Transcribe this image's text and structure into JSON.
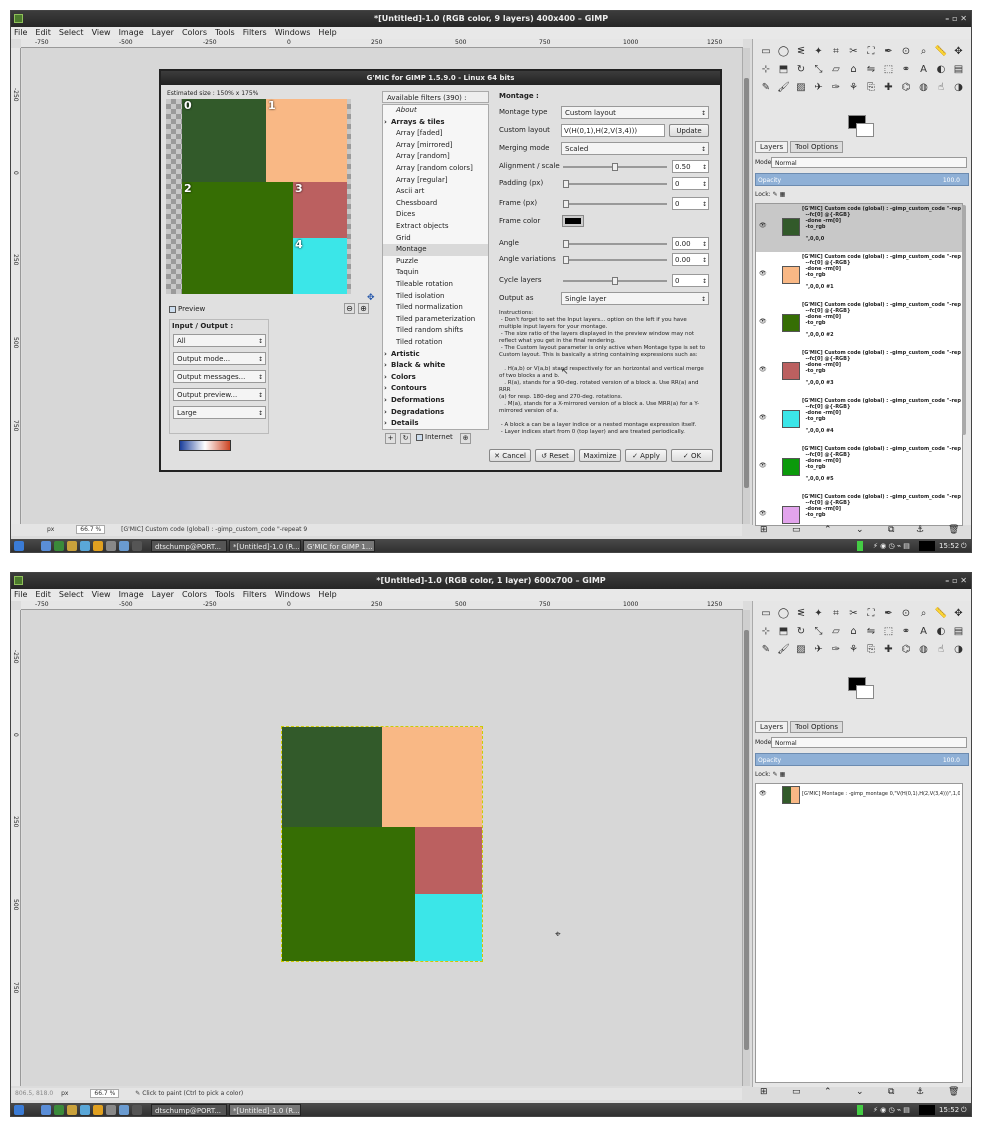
{
  "screen1": {
    "title": "*[Untitled]-1.0 (RGB color, 9 layers) 400x400 – GIMP",
    "menus": [
      "File",
      "Edit",
      "Select",
      "View",
      "Image",
      "Layer",
      "Colors",
      "Tools",
      "Filters",
      "Windows",
      "Help"
    ],
    "ruler_h": [
      "-750",
      "-500",
      "-250",
      "0",
      "250",
      "500",
      "750",
      "1000",
      "1250"
    ],
    "ruler_v": [
      "-250",
      "0",
      "250",
      "500",
      "750"
    ],
    "status": {
      "unit": "px",
      "zoom": "66.7 %",
      "message": "[G'MIC] Custom code (global) : -gimp_custom_code \"-repeat 9"
    },
    "gmic": {
      "title": "G'MIC for GIMP 1.5.9.0 - Linux 64 bits",
      "estimated": "Estimated size : 150% x 175%",
      "preview_blocks": [
        {
          "n": "0",
          "color": "#325a2a"
        },
        {
          "n": "1",
          "color": "#f9b885"
        },
        {
          "n": "2",
          "color": "#366e04"
        },
        {
          "n": "3",
          "color": "#bb6060"
        },
        {
          "n": "4",
          "color": "#3be6e8"
        }
      ],
      "preview_label": "Preview",
      "io_title": "Input / Output :",
      "io": [
        "All",
        "Output mode...",
        "Output messages...",
        "Output preview...",
        "Large"
      ],
      "filters_header": "Available filters (390) :",
      "filters": [
        {
          "t": "About",
          "k": "sub-it"
        },
        {
          "t": "Arrays & tiles",
          "k": "cat"
        },
        {
          "t": "Array [faded]",
          "k": "sub"
        },
        {
          "t": "Array [mirrored]",
          "k": "sub"
        },
        {
          "t": "Array [random]",
          "k": "sub"
        },
        {
          "t": "Array [random colors]",
          "k": "sub"
        },
        {
          "t": "Array [regular]",
          "k": "sub"
        },
        {
          "t": "Ascii art",
          "k": "sub"
        },
        {
          "t": "Chessboard",
          "k": "sub"
        },
        {
          "t": "Dices",
          "k": "sub"
        },
        {
          "t": "Extract objects",
          "k": "sub"
        },
        {
          "t": "Grid",
          "k": "sub"
        },
        {
          "t": "Montage",
          "k": "on"
        },
        {
          "t": "Puzzle",
          "k": "sub"
        },
        {
          "t": "Taquin",
          "k": "sub"
        },
        {
          "t": "Tileable rotation",
          "k": "sub"
        },
        {
          "t": "Tiled isolation",
          "k": "sub"
        },
        {
          "t": "Tiled normalization",
          "k": "sub"
        },
        {
          "t": "Tiled parameterization",
          "k": "sub"
        },
        {
          "t": "Tiled random shifts",
          "k": "sub"
        },
        {
          "t": "Tiled rotation",
          "k": "sub"
        },
        {
          "t": "Artistic",
          "k": "cat"
        },
        {
          "t": "Black & white",
          "k": "cat"
        },
        {
          "t": "Colors",
          "k": "cat"
        },
        {
          "t": "Contours",
          "k": "cat"
        },
        {
          "t": "Deformations",
          "k": "cat"
        },
        {
          "t": "Degradations",
          "k": "cat"
        },
        {
          "t": "Details",
          "k": "cat"
        }
      ],
      "internet": "Internet",
      "params_title": "Montage :",
      "montage_type_label": "Montage type",
      "montage_type": "Custom layout",
      "custom_layout_label": "Custom layout",
      "custom_layout": "V(H(0,1),H(2,V(3,4)))",
      "update": "Update",
      "merging_label": "Merging mode",
      "merging": "Scaled",
      "align_label": "Alignment / scale",
      "align": "0.50",
      "align_pos": 0.5,
      "padding_label": "Padding (px)",
      "padding": "0",
      "frame_label": "Frame (px)",
      "frame": "0",
      "frame_color_label": "Frame color",
      "frame_color": "#000000",
      "angle_label": "Angle",
      "angle": "0.00",
      "anglevar_label": "Angle variations",
      "anglevar": "0.00",
      "cycle_label": "Cycle layers",
      "cycle": "0",
      "cycle_pos": 0.5,
      "output_label": "Output as",
      "output": "Single layer",
      "instructions": "Instructions:\n - Don't forget to set the Input layers... option on the left if you have\nmultiple input layers for your montage.\n - The size ratio of the layers displayed in the preview window may not\nreflect what you get in the final rendering.\n - The Custom layout parameter is only active when Montage type is set to\nCustom layout. This is basically a string containing expressions such as:\n\n   . H(a,b) or V(a,b) stand respectively for an horizontal and vertical merge\nof two blocks a and b.\n   . R(a), stands for a 90-deg. rotated version of a block a. Use RR(a) and RRR\n(a) for resp. 180-deg and 270-deg. rotations.\n   . M(a), stands for a X-mirrored version of a block a. Use MRR(a) for a Y-\nmirrored version of a.\n\n - A block a can be a layer indice or a nested montage expression itself.\n - Layer indices start from 0 (top layer) and are treated periodically.",
      "buttons": [
        "Cancel",
        "Reset",
        "Maximize",
        "Apply",
        "OK"
      ]
    },
    "dock": {
      "tab_layers": "Layers",
      "tab_tool": "Tool Options",
      "mode_label": "Mode:",
      "mode": "Normal",
      "opacity_label": "Opacity",
      "opacity": "100.0",
      "lock_label": "Lock:",
      "layers": [
        {
          "text": "[G'MIC] Custom code (global) : -gimp_custom_code \"-rep\n  --fc[0] @{-RGB}\n  -done -rm[0]\n  -to_rgb\n\n  \",0,0,0",
          "color": "#325a2a",
          "sel": true
        },
        {
          "text": "[G'MIC] Custom code (global) : -gimp_custom_code \"-rep\n  --fc[0] @{-RGB}\n  -done -rm[0]\n  -to_rgb\n\n  \",0,0,0 #1",
          "color": "#f9b885",
          "sel": false
        },
        {
          "text": "[G'MIC] Custom code (global) : -gimp_custom_code \"-rep\n  --fc[0] @{-RGB}\n  -done -rm[0]\n  -to_rgb\n\n  \",0,0,0 #2",
          "color": "#366e04",
          "sel": false
        },
        {
          "text": "[G'MIC] Custom code (global) : -gimp_custom_code \"-rep\n  --fc[0] @{-RGB}\n  -done -rm[0]\n  -to_rgb\n\n  \",0,0,0 #3",
          "color": "#bb6060",
          "sel": false
        },
        {
          "text": "[G'MIC] Custom code (global) : -gimp_custom_code \"-rep\n  --fc[0] @{-RGB}\n  -done -rm[0]\n  -to_rgb\n\n  \",0,0,0 #4",
          "color": "#3be6e8",
          "sel": false
        },
        {
          "text": "[G'MIC] Custom code (global) : -gimp_custom_code \"-rep\n  --fc[0] @{-RGB}\n  -done -rm[0]\n  -to_rgb\n\n  \",0,0,0 #5",
          "color": "#0b9a0b",
          "sel": false
        },
        {
          "text": "[G'MIC] Custom code (global) : -gimp_custom_code \"-rep\n  --fc[0] @{-RGB}\n  -done -rm[0]\n  -to_rgb",
          "color": "#e2a4ec",
          "sel": false
        }
      ]
    },
    "taskbar": {
      "items": [
        "dtschump@PORT...",
        "*[Untitled]-1.0 (R...",
        "G'MIC for GIMP 1..."
      ],
      "time": "15:52"
    }
  },
  "screen2": {
    "title": "*[Untitled]-1.0 (RGB color, 1 layer) 600x700 – GIMP",
    "menus": [
      "File",
      "Edit",
      "Select",
      "View",
      "Image",
      "Layer",
      "Colors",
      "Tools",
      "Filters",
      "Windows",
      "Help"
    ],
    "ruler_h": [
      "-750",
      "-500",
      "-250",
      "0",
      "250",
      "500",
      "750",
      "1000",
      "1250"
    ],
    "ruler_v": [
      "-250",
      "0",
      "250",
      "500",
      "750"
    ],
    "status": {
      "coords": "806.5, 818.0",
      "unit": "px",
      "zoom": "66.7 %",
      "message": "Click to paint (Ctrl to pick a color)"
    },
    "dock": {
      "tab_layers": "Layers",
      "tab_tool": "Tool Options",
      "mode_label": "Mode:",
      "mode": "Normal",
      "opacity_label": "Opacity",
      "opacity": "100.0",
      "lock_label": "Lock:",
      "layer_text": "[G'MIC] Montage : -gimp_montage 0,\"V(H(0,1),H(2,V(3,4)))\",1,0"
    },
    "taskbar": {
      "items": [
        "dtschump@PORT...",
        "*[Untitled]-1.0 (R..."
      ],
      "time": "15:52"
    }
  },
  "colors": {
    "c0": "#325a2a",
    "c1": "#f9b885",
    "c2": "#366e04",
    "c3": "#bb6060",
    "c4": "#3be6e8"
  }
}
